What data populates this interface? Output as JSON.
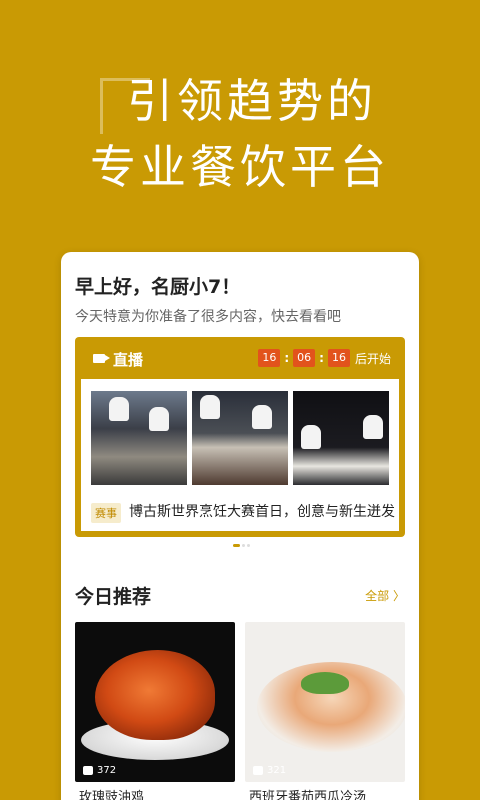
{
  "hero": {
    "line1": "引领趋势的",
    "line2": "专业餐饮平台"
  },
  "greeting": {
    "title": "早上好，名厨小7！",
    "subtitle": "今天特意为你准备了很多内容，快去看看吧"
  },
  "live": {
    "label": "直播",
    "timer": [
      "16",
      "06",
      "16"
    ],
    "after": "后开始",
    "tag": "赛事",
    "headline": "博古斯世界烹饪大赛首日，创意与新生迸发"
  },
  "recommend": {
    "title": "今日推荐",
    "all_label": "全部 〉",
    "items": [
      {
        "name": "玫瑰豉油鸡",
        "likes": "372"
      },
      {
        "name": "西班牙番茄西瓜冷汤",
        "likes": "321"
      }
    ]
  },
  "colors": {
    "brand": "#c99a04",
    "timer": "#e2531c"
  }
}
